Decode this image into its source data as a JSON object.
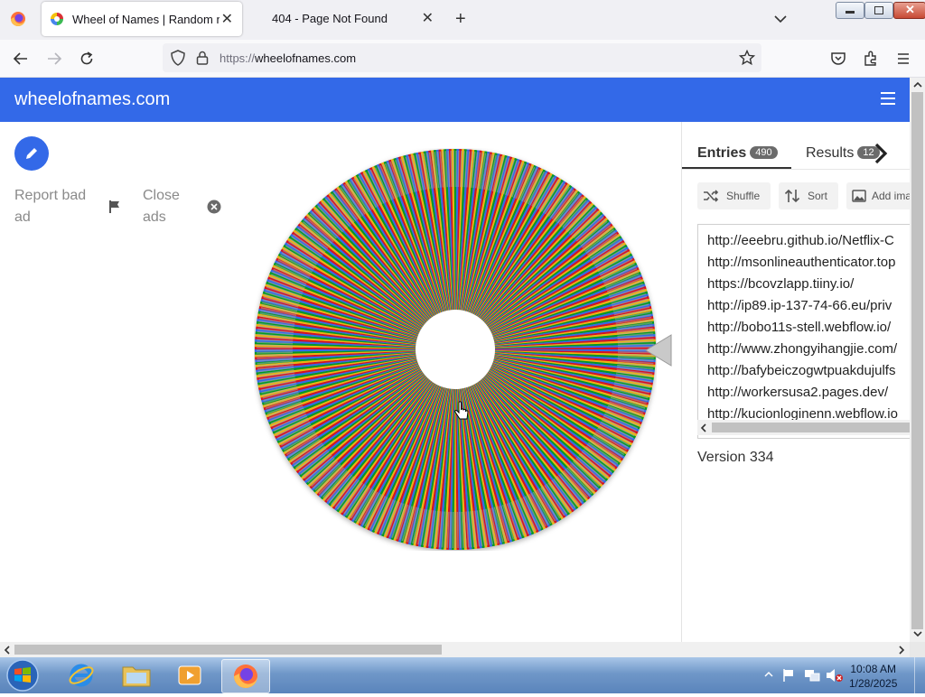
{
  "browser": {
    "tabs": [
      {
        "title": "Wheel of Names | Random name picker",
        "active": true
      },
      {
        "title": "404 - Page Not Found",
        "active": false
      }
    ],
    "url_scheme": "https://",
    "url_host": "wheelofnames.com"
  },
  "page": {
    "brand": "wheelofnames.com",
    "ads": {
      "report_label": "Report bad ad",
      "close_label": "Close ads"
    },
    "panel": {
      "tab_entries": "Entries",
      "entries_count": "490",
      "tab_results": "Results",
      "results_count": "12",
      "shuffle_label": "Shuffle",
      "sort_label": "Sort",
      "add_image_label": "Add image",
      "entries": [
        "http://eeebru.github.io/Netflix-C",
        "http://msonlineauthenticator.top",
        "https://bcovzlapp.tiiny.io/",
        "http://ip89.ip-137-74-66.eu/priv",
        "http://bobo11s-stell.webflow.io/",
        "http://www.zhongyihangjie.com/",
        "http://bafybeiczogwtpuakdujulfs",
        "http://workersusa2.pages.dev/",
        "http://kucionloginenn.webflow.io"
      ],
      "version": "Version 334"
    },
    "colors": {
      "accent": "#3369e8"
    }
  },
  "taskbar": {
    "time": "10:08 AM",
    "date": "1/28/2025",
    "apps": [
      "internet-explorer",
      "file-explorer",
      "media-player",
      "firefox"
    ]
  }
}
